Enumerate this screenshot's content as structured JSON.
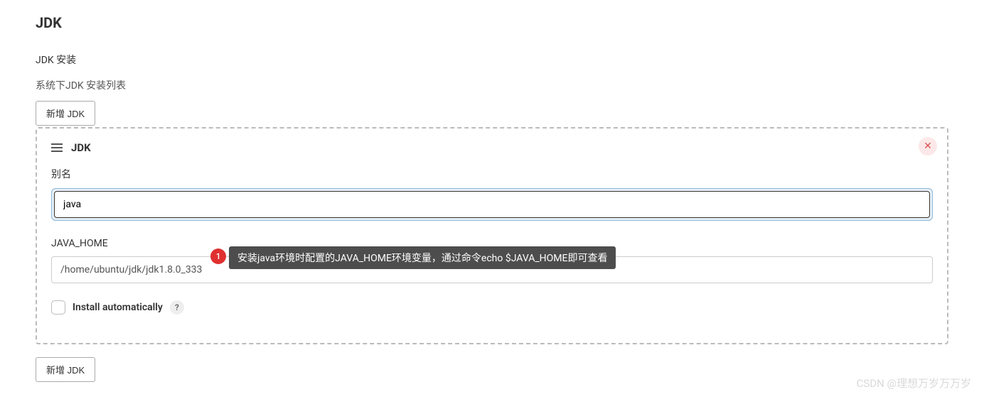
{
  "section": {
    "title": "JDK",
    "subtitle": "JDK 安装",
    "list_label": "系统下JDK 安装列表"
  },
  "buttons": {
    "add_jdk": "新增 JDK"
  },
  "panel": {
    "title": "JDK",
    "close_icon": "✕"
  },
  "fields": {
    "alias_label": "别名",
    "alias_value": "java",
    "java_home_label": "JAVA_HOME",
    "java_home_value": "/home/ubuntu/jdk/jdk1.8.0_333",
    "install_auto_label": "Install automatically"
  },
  "annotation": {
    "badge": "1",
    "text": "安装java环境时配置的JAVA_HOME环境变量，通过命令echo $JAVA_HOME即可查看"
  },
  "help": {
    "question": "?"
  },
  "watermark": "CSDN @理想万岁万万岁"
}
